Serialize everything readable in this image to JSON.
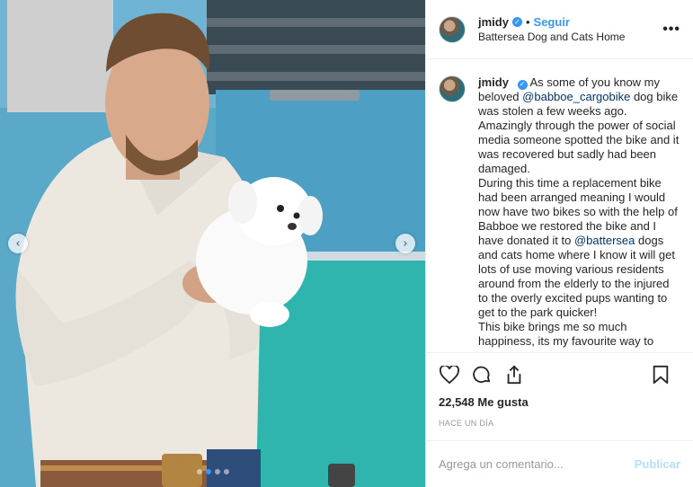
{
  "post": {
    "username": "jmidy",
    "separator": "•",
    "follow_label": "Seguir",
    "location": "Battersea Dog and Cats Home",
    "more_icon": "more-options-icon",
    "more_label": "•••"
  },
  "caption": {
    "username": "jmidy",
    "text_1": "As some of you know my beloved ",
    "mention_1": "@babboe_cargobike",
    "text_2": " dog bike was stolen a few weeks ago. Amazingly through the power of social media someone spotted the bike and it was recovered but sadly had been damaged.",
    "text_3": "During this time a replacement bike had been arranged meaning I would now have two bikes so with the help of Babboe we restored the bike and I have donated it to ",
    "mention_2": "@battersea",
    "text_4": " dogs and cats home where I know it will get lots of use moving various residents around from the elderly to the injured to the overly excited pups wanting to get to the park quicker!",
    "text_5": "This bike brings me so much happiness, its my favourite way to"
  },
  "actions": {
    "like_icon": "heart-icon",
    "comment_icon": "comment-bubble-icon",
    "share_icon": "share-icon",
    "save_icon": "bookmark-icon"
  },
  "likes": "22,548 Me gusta",
  "timestamp": "HACE UN DÍA",
  "comment": {
    "placeholder": "Agrega un comentario...",
    "publish_label": "Publicar"
  },
  "carousel": {
    "prev_label": "‹",
    "next_label": "›",
    "dot_count": 4,
    "active_index": 1
  },
  "colors": {
    "accent": "#3897f0",
    "publish_disabled": "#b2dffc",
    "mention": "#003569"
  }
}
